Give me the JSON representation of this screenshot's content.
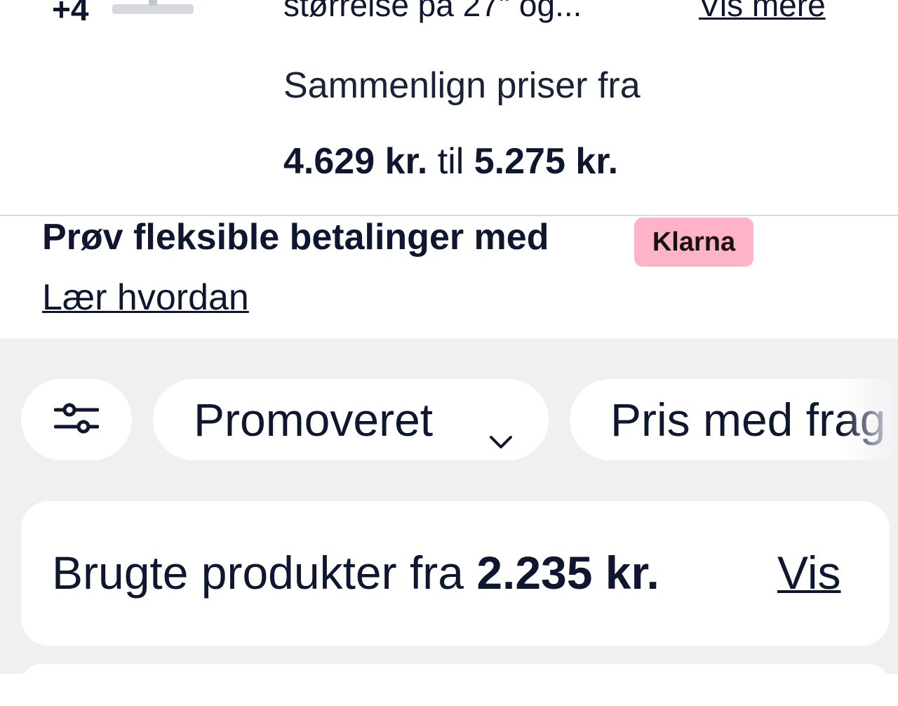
{
  "top_card": {
    "more_images_count": "+4",
    "description_partial": "størrelse på 27\" og...",
    "show_more_link": "Vis mere",
    "compare_label": "Sammenlign priser fra",
    "price_min": "4.629 kr.",
    "price_sep": " til ",
    "price_max": "5.275 kr."
  },
  "klarna": {
    "title": "Prøv fleksible betalinger med",
    "badge": "Klarna",
    "learn_link": "Lær hvordan"
  },
  "filters": {
    "filter_icon": "sliders-icon",
    "sort_label": "Promoveret",
    "sort_icon": "chevron-down-icon",
    "price_chip_label": "Pris med frag"
  },
  "used_products": {
    "text": "Brugte produkter fra ",
    "price": "2.235 kr.",
    "link": "Vis"
  }
}
